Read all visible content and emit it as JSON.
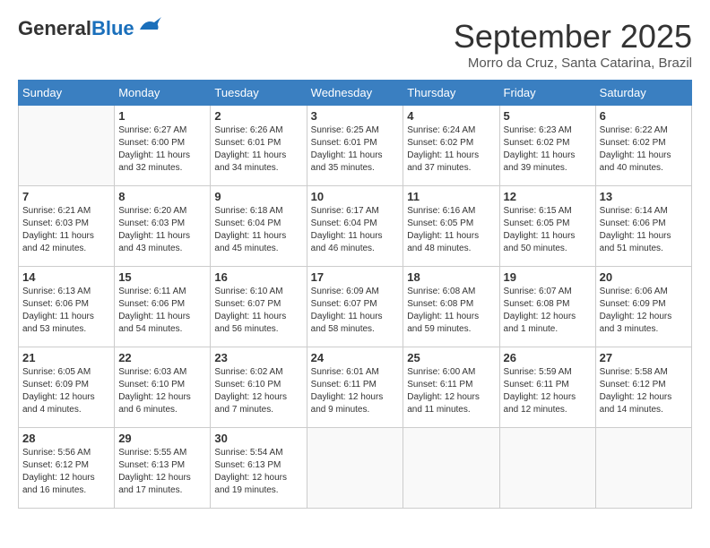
{
  "header": {
    "logo_general": "General",
    "logo_blue": "Blue",
    "month": "September 2025",
    "location": "Morro da Cruz, Santa Catarina, Brazil"
  },
  "weekdays": [
    "Sunday",
    "Monday",
    "Tuesday",
    "Wednesday",
    "Thursday",
    "Friday",
    "Saturday"
  ],
  "weeks": [
    [
      {
        "day": "",
        "info": ""
      },
      {
        "day": "1",
        "info": "Sunrise: 6:27 AM\nSunset: 6:00 PM\nDaylight: 11 hours\nand 32 minutes."
      },
      {
        "day": "2",
        "info": "Sunrise: 6:26 AM\nSunset: 6:01 PM\nDaylight: 11 hours\nand 34 minutes."
      },
      {
        "day": "3",
        "info": "Sunrise: 6:25 AM\nSunset: 6:01 PM\nDaylight: 11 hours\nand 35 minutes."
      },
      {
        "day": "4",
        "info": "Sunrise: 6:24 AM\nSunset: 6:02 PM\nDaylight: 11 hours\nand 37 minutes."
      },
      {
        "day": "5",
        "info": "Sunrise: 6:23 AM\nSunset: 6:02 PM\nDaylight: 11 hours\nand 39 minutes."
      },
      {
        "day": "6",
        "info": "Sunrise: 6:22 AM\nSunset: 6:02 PM\nDaylight: 11 hours\nand 40 minutes."
      }
    ],
    [
      {
        "day": "7",
        "info": "Sunrise: 6:21 AM\nSunset: 6:03 PM\nDaylight: 11 hours\nand 42 minutes."
      },
      {
        "day": "8",
        "info": "Sunrise: 6:20 AM\nSunset: 6:03 PM\nDaylight: 11 hours\nand 43 minutes."
      },
      {
        "day": "9",
        "info": "Sunrise: 6:18 AM\nSunset: 6:04 PM\nDaylight: 11 hours\nand 45 minutes."
      },
      {
        "day": "10",
        "info": "Sunrise: 6:17 AM\nSunset: 6:04 PM\nDaylight: 11 hours\nand 46 minutes."
      },
      {
        "day": "11",
        "info": "Sunrise: 6:16 AM\nSunset: 6:05 PM\nDaylight: 11 hours\nand 48 minutes."
      },
      {
        "day": "12",
        "info": "Sunrise: 6:15 AM\nSunset: 6:05 PM\nDaylight: 11 hours\nand 50 minutes."
      },
      {
        "day": "13",
        "info": "Sunrise: 6:14 AM\nSunset: 6:06 PM\nDaylight: 11 hours\nand 51 minutes."
      }
    ],
    [
      {
        "day": "14",
        "info": "Sunrise: 6:13 AM\nSunset: 6:06 PM\nDaylight: 11 hours\nand 53 minutes."
      },
      {
        "day": "15",
        "info": "Sunrise: 6:11 AM\nSunset: 6:06 PM\nDaylight: 11 hours\nand 54 minutes."
      },
      {
        "day": "16",
        "info": "Sunrise: 6:10 AM\nSunset: 6:07 PM\nDaylight: 11 hours\nand 56 minutes."
      },
      {
        "day": "17",
        "info": "Sunrise: 6:09 AM\nSunset: 6:07 PM\nDaylight: 11 hours\nand 58 minutes."
      },
      {
        "day": "18",
        "info": "Sunrise: 6:08 AM\nSunset: 6:08 PM\nDaylight: 11 hours\nand 59 minutes."
      },
      {
        "day": "19",
        "info": "Sunrise: 6:07 AM\nSunset: 6:08 PM\nDaylight: 12 hours\nand 1 minute."
      },
      {
        "day": "20",
        "info": "Sunrise: 6:06 AM\nSunset: 6:09 PM\nDaylight: 12 hours\nand 3 minutes."
      }
    ],
    [
      {
        "day": "21",
        "info": "Sunrise: 6:05 AM\nSunset: 6:09 PM\nDaylight: 12 hours\nand 4 minutes."
      },
      {
        "day": "22",
        "info": "Sunrise: 6:03 AM\nSunset: 6:10 PM\nDaylight: 12 hours\nand 6 minutes."
      },
      {
        "day": "23",
        "info": "Sunrise: 6:02 AM\nSunset: 6:10 PM\nDaylight: 12 hours\nand 7 minutes."
      },
      {
        "day": "24",
        "info": "Sunrise: 6:01 AM\nSunset: 6:11 PM\nDaylight: 12 hours\nand 9 minutes."
      },
      {
        "day": "25",
        "info": "Sunrise: 6:00 AM\nSunset: 6:11 PM\nDaylight: 12 hours\nand 11 minutes."
      },
      {
        "day": "26",
        "info": "Sunrise: 5:59 AM\nSunset: 6:11 PM\nDaylight: 12 hours\nand 12 minutes."
      },
      {
        "day": "27",
        "info": "Sunrise: 5:58 AM\nSunset: 6:12 PM\nDaylight: 12 hours\nand 14 minutes."
      }
    ],
    [
      {
        "day": "28",
        "info": "Sunrise: 5:56 AM\nSunset: 6:12 PM\nDaylight: 12 hours\nand 16 minutes."
      },
      {
        "day": "29",
        "info": "Sunrise: 5:55 AM\nSunset: 6:13 PM\nDaylight: 12 hours\nand 17 minutes."
      },
      {
        "day": "30",
        "info": "Sunrise: 5:54 AM\nSunset: 6:13 PM\nDaylight: 12 hours\nand 19 minutes."
      },
      {
        "day": "",
        "info": ""
      },
      {
        "day": "",
        "info": ""
      },
      {
        "day": "",
        "info": ""
      },
      {
        "day": "",
        "info": ""
      }
    ]
  ]
}
